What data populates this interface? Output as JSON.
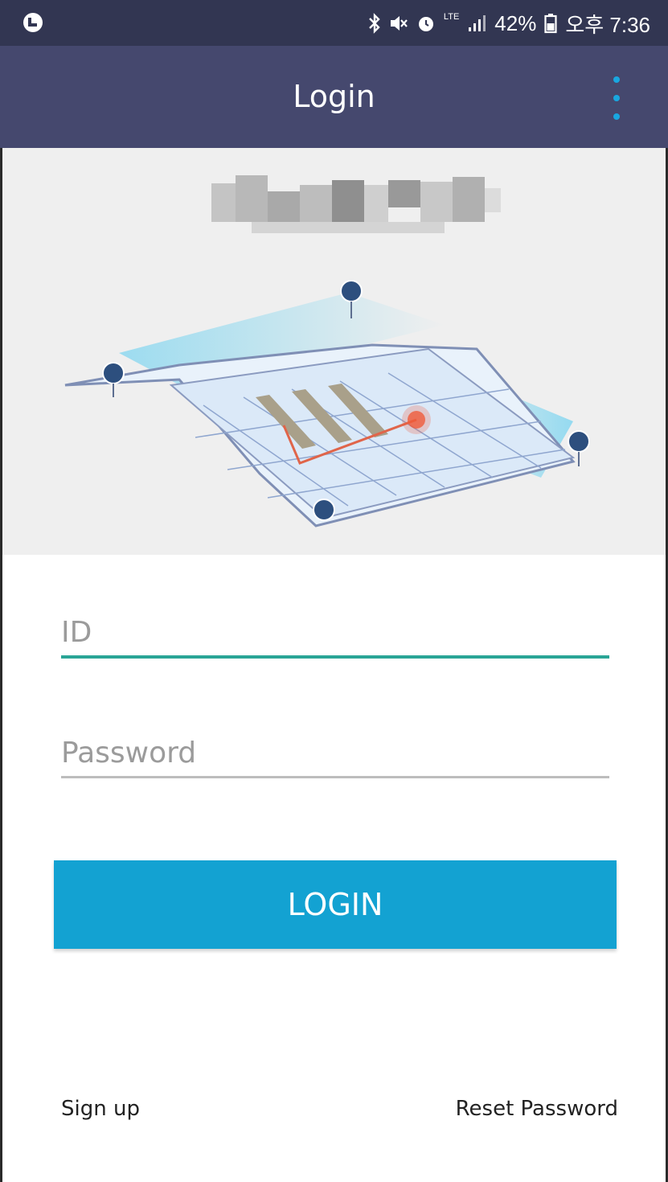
{
  "status_bar": {
    "network": "LTE",
    "battery": "42%",
    "time": "오후 7:36",
    "icons": [
      "app-notification-icon",
      "bluetooth-icon",
      "mute-icon",
      "alarm-icon",
      "signal-icon",
      "battery-icon"
    ]
  },
  "app_bar": {
    "title": "Login",
    "menu_icon": "overflow-menu-icon"
  },
  "hero": {
    "logo": "blurred-logo",
    "illustration": "indoor-map-illustration"
  },
  "form": {
    "id": {
      "value": "",
      "placeholder": "ID"
    },
    "password": {
      "value": "",
      "placeholder": "Password"
    },
    "login_label": "LOGIN"
  },
  "footer": {
    "sign_up": "Sign up",
    "reset_password": "Reset Password"
  },
  "colors": {
    "status_bar": "#323652",
    "app_bar": "#45486e",
    "accent": "#19a7e0",
    "button": "#13a2d2",
    "id_underline": "#2aa596"
  }
}
